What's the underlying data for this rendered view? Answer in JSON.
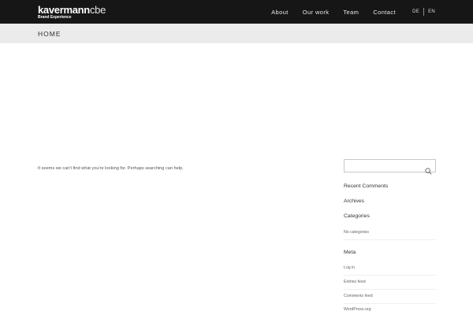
{
  "header": {
    "logo": {
      "main_bold": "kavermann",
      "main_light": "cbe",
      "tagline": "Brand Experience"
    },
    "nav": [
      "About",
      "Our work",
      "Team",
      "Contact"
    ],
    "languages": [
      "DE",
      "EN"
    ]
  },
  "titlebar": {
    "title": "HOME"
  },
  "main": {
    "message": "It seems we can't find what you're looking for. Perhaps searching can help."
  },
  "sidebar": {
    "search": {
      "value": "",
      "icon": "search-icon"
    },
    "recent_comments": "Recent Comments",
    "archives": "Archives",
    "categories": {
      "title": "Categories",
      "items": [
        "No categories"
      ]
    },
    "meta": {
      "title": "Meta",
      "items": [
        "Log in",
        "Entries feed",
        "Comments feed",
        "WordPress.org"
      ]
    }
  },
  "colors": {
    "header_bg": "#161616",
    "titlebar_bg": "#ebebeb",
    "text": "#333333"
  }
}
